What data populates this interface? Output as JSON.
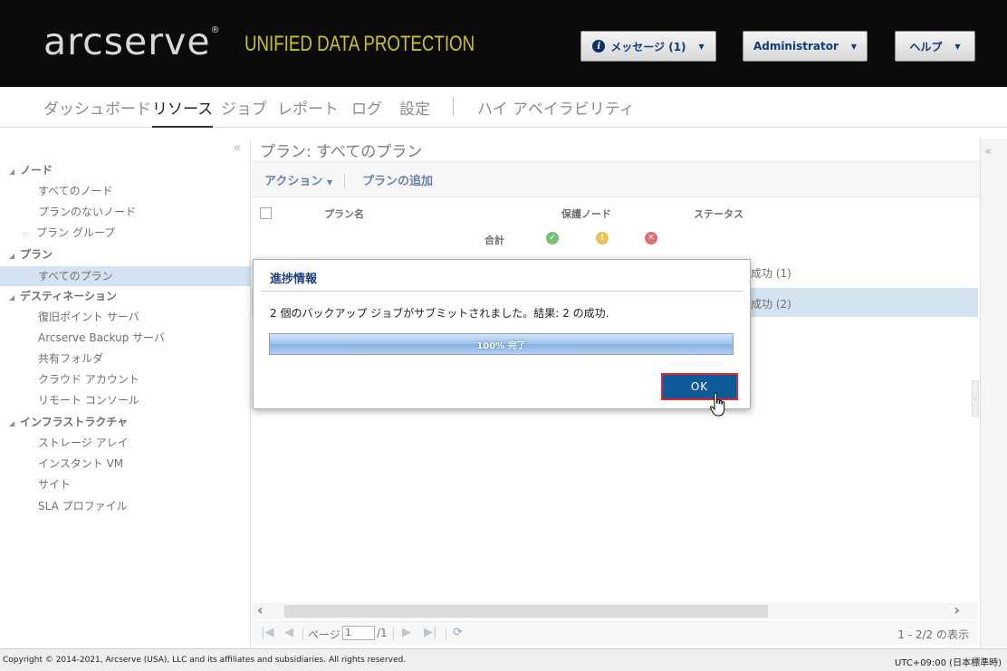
{
  "header": {
    "logo": "arcserve",
    "logo_mark": "®",
    "tagline": "UNIFIED DATA PROTECTION",
    "messages_label": "メッセージ (1)",
    "user_label": "Administrator",
    "help_label": "ヘルプ"
  },
  "nav": {
    "items": [
      "ダッシュボード",
      "リソース",
      "ジョブ",
      "レポート",
      "ログ",
      "設定",
      "ハイ アベイラビリティ"
    ],
    "active": "リソース"
  },
  "sidebar": {
    "collapse_icon": "«",
    "node_group": "ノード",
    "node_all": "すべてのノード",
    "node_unassigned": "プランのないノード",
    "node_plan_group": "プラン グループ",
    "plan_group": "プラン",
    "plan_all": "すべてのプラン",
    "dest_group": "デスティネーション",
    "dest_rps": "復旧ポイント サーバ",
    "dest_arcserve_backup": "Arcserve Backup サーバ",
    "dest_share": "共有フォルダ",
    "dest_cloud": "クラウド アカウント",
    "dest_remote": "リモート コンソール",
    "infra_group": "インフラストラクチャ",
    "infra_storage": "ストレージ アレイ",
    "infra_instant_vm": "インスタント VM",
    "infra_site": "サイト",
    "infra_sla": "SLA プロファイル"
  },
  "main": {
    "title": "プラン: すべてのプラン",
    "actions_label": "アクション",
    "add_plan_label": "プランの追加",
    "columns": {
      "plan_name": "プラン名",
      "protected_nodes": "保護ノード",
      "status": "ステータス"
    },
    "totals_label": "合計",
    "rows": [
      {
        "status": "成功 (1)"
      },
      {
        "status": "成功 (2)"
      }
    ],
    "pager": {
      "page_label": "ページ",
      "page_value": "1",
      "page_total": "/1",
      "count": "1 - 2/2 の表示"
    }
  },
  "dialog": {
    "title": "進捗情報",
    "message": "2 個のバックアップ ジョブがサブミットされました。結果: 2 の成功.",
    "progress_text": "100% 完了",
    "progress": 1.0,
    "ok_label": "OK"
  },
  "footer": {
    "copyright": "Copyright © 2014-2021, Arcserve (USA), LLC and its affiliates and subsidiaries. All rights reserved.",
    "timezone": "UTC+09:00 (日本標準時)"
  },
  "colors": {
    "header_bg": "#0b0b0b",
    "tagline": "#c9c220",
    "selected_row": "#bcd4ea",
    "ok_button": "#0f5a98",
    "highlight_border": "#e0262b",
    "success": "#2e9e3a",
    "warning": "#e0a000",
    "error": "#d0202a"
  }
}
